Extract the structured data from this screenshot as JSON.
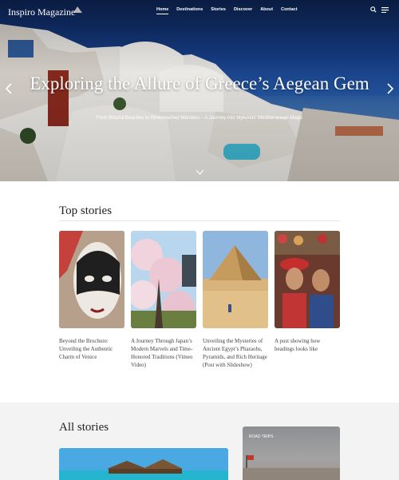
{
  "site": {
    "name": "Inspiro Magazine"
  },
  "nav": {
    "items": [
      "Home",
      "Destinations",
      "Stories",
      "Discover",
      "About",
      "Contact"
    ]
  },
  "hero": {
    "title": "Exploring the Allure of Greece’s Aegean Gem",
    "subtitle": "From Blissful Beaches to Whitewashed Wonders – A Journey into Mykonos' Mediterranean Magic"
  },
  "top_stories": {
    "heading": "Top stories",
    "items": [
      {
        "caption": "Beyond the Brochure: Unveiling the Authentic Charm of Venice"
      },
      {
        "caption": "A Journey Through Japan’s Modern Marvels and Time-Honored Traditions (Vimeo Video)"
      },
      {
        "caption": "Unveiling the Mysteries of Ancient Egypt’s Pharaohs, Pyramids, and Rich Heritage (Post with Slideshow)"
      },
      {
        "caption": "A post showing how headings looks like"
      }
    ]
  },
  "all_stories": {
    "heading": "All stories",
    "side_card_tag": "ROAD TRIPS"
  },
  "colors": {
    "hero_sea": "#163e88",
    "text": "#222222",
    "section_bg": "#f3f3f3"
  },
  "icons": [
    "search-icon",
    "menu-icon",
    "chevron-left-icon",
    "chevron-right-icon",
    "chevron-down-icon"
  ]
}
